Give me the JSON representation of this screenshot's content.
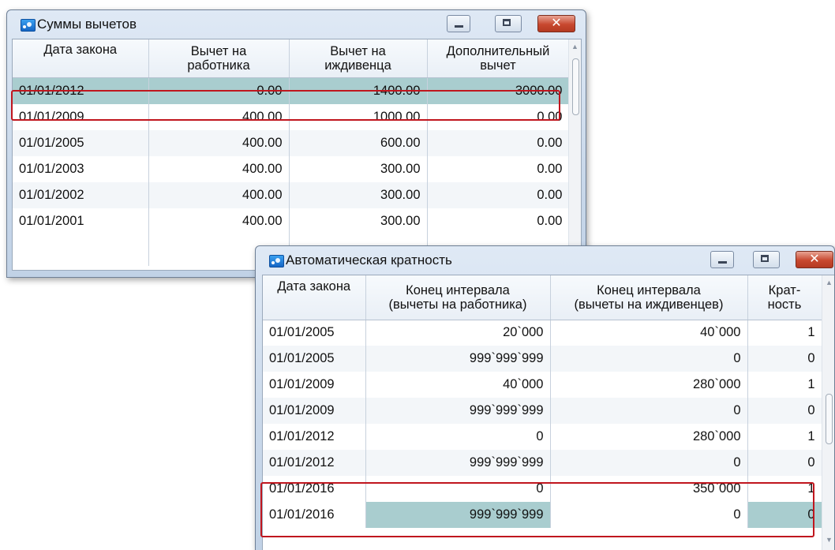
{
  "window1": {
    "title": "Суммы вычетов",
    "columns": [
      {
        "line1": "Дата закона",
        "line2": ""
      },
      {
        "line1": "Вычет на",
        "line2": "работника"
      },
      {
        "line1": "Вычет на",
        "line2": "иждивенца"
      },
      {
        "line1": "Дополнительный",
        "line2": "вычет"
      }
    ],
    "rows": [
      {
        "date": "01/01/2012",
        "employee": "0.00",
        "dependent": "1400.00",
        "additional": "3000.00"
      },
      {
        "date": "01/01/2009",
        "employee": "400.00",
        "dependent": "1000.00",
        "additional": "0.00"
      },
      {
        "date": "01/01/2005",
        "employee": "400.00",
        "dependent": "600.00",
        "additional": "0.00"
      },
      {
        "date": "01/01/2003",
        "employee": "400.00",
        "dependent": "300.00",
        "additional": "0.00"
      },
      {
        "date": "01/01/2002",
        "employee": "400.00",
        "dependent": "300.00",
        "additional": "0.00"
      },
      {
        "date": "01/01/2001",
        "employee": "400.00",
        "dependent": "300.00",
        "additional": "0.00"
      }
    ]
  },
  "window2": {
    "title": "Автоматическая кратность",
    "columns": [
      {
        "line1": "Дата закона",
        "line2": ""
      },
      {
        "line1": "Конец интервала",
        "line2": "(вычеты на работника)"
      },
      {
        "line1": "Конец интервала",
        "line2": "(вычеты на иждивенцев)"
      },
      {
        "line1": "Крат-",
        "line2": "ность"
      }
    ],
    "rows": [
      {
        "date": "01/01/2005",
        "employee_end": "20`000",
        "dependent_end": "40`000",
        "multiplicity": "1"
      },
      {
        "date": "01/01/2005",
        "employee_end": "999`999`999",
        "dependent_end": "0",
        "multiplicity": "0"
      },
      {
        "date": "01/01/2009",
        "employee_end": "40`000",
        "dependent_end": "280`000",
        "multiplicity": "1"
      },
      {
        "date": "01/01/2009",
        "employee_end": "999`999`999",
        "dependent_end": "0",
        "multiplicity": "0"
      },
      {
        "date": "01/01/2012",
        "employee_end": "0",
        "dependent_end": "280`000",
        "multiplicity": "1"
      },
      {
        "date": "01/01/2012",
        "employee_end": "999`999`999",
        "dependent_end": "0",
        "multiplicity": "0"
      },
      {
        "date": "01/01/2016",
        "employee_end": "0",
        "dependent_end": "350`000",
        "multiplicity": "1"
      },
      {
        "date": "01/01/2016",
        "employee_end": "999`999`999",
        "dependent_end": "0",
        "multiplicity": "0"
      }
    ]
  },
  "colors": {
    "selected_row": "#a9cdcf",
    "highlight_frame": "#c0161e",
    "window_frame": "#c9d8ea"
  }
}
